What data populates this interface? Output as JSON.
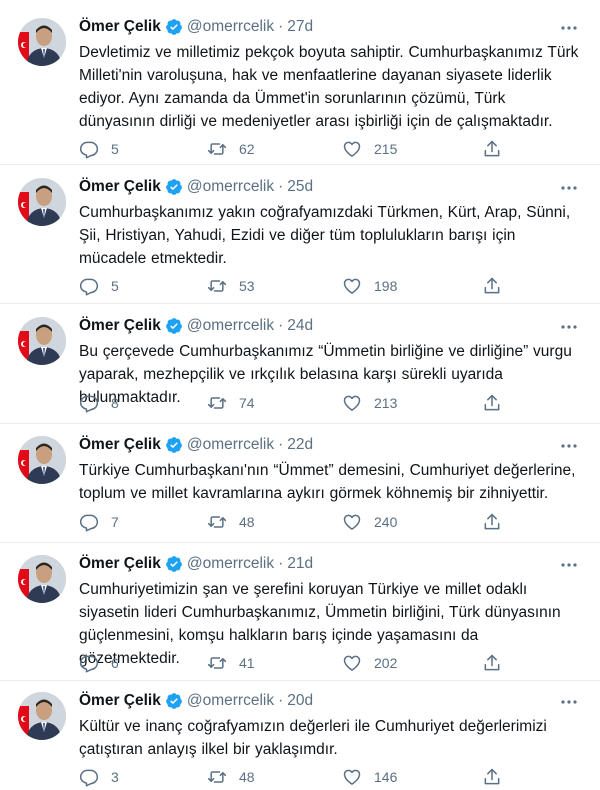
{
  "colors": {
    "text": "#0f1419",
    "secondary": "#5b7083",
    "verified_blue": "#1da1f2",
    "divider": "#e6ecf0",
    "flag_red": "#e30a17"
  },
  "icons": {
    "verified": "verified-badge-icon",
    "more": "more-horizontal-icon",
    "reply": "reply-icon",
    "retweet": "retweet-icon",
    "like": "heart-icon",
    "share": "share-icon"
  },
  "tweets": [
    {
      "author": {
        "name": "Ömer Çelik",
        "handle": "@omerrcelik"
      },
      "separator": "·",
      "time": "27d",
      "text": "Devletimiz ve milletimiz  pekçok boyuta sahiptir. Cumhurbaşkanımız Türk Milleti'nin varoluşuna, hak ve menfaatlerine dayanan siyasete liderlik ediyor. Aynı zamanda da Ümmet'in sorunlarının çözümü, Türk dünyasının dirliği ve medeniyetler arası işbirliği için de çalışmaktadır.",
      "replies": "5",
      "retweets": "62",
      "likes": "215"
    },
    {
      "author": {
        "name": "Ömer Çelik",
        "handle": "@omerrcelik"
      },
      "separator": "·",
      "time": "25d",
      "text": "Cumhurbaşkanımız yakın coğrafyamızdaki Türkmen, Kürt, Arap, Sünni, Şii, Hristiyan, Yahudi, Ezidi ve diğer tüm toplulukların barışı için mücadele etmektedir.",
      "replies": "5",
      "retweets": "53",
      "likes": "198"
    },
    {
      "author": {
        "name": "Ömer Çelik",
        "handle": "@omerrcelik"
      },
      "separator": "·",
      "time": "24d",
      "text": "Bu çerçevede Cumhurbaşkanımız “Ümmetin birliğine ve dirliğine” vurgu yaparak, mezhepçilik ve ırkçılık belasına karşı sürekli uyarıda bulunmaktadır.",
      "replies": "8",
      "retweets": "74",
      "likes": "213"
    },
    {
      "author": {
        "name": "Ömer Çelik",
        "handle": "@omerrcelik"
      },
      "separator": "·",
      "time": "22d",
      "text": "Türkiye Cumhurbaşkanı'nın “Ümmet” demesini, Cumhuriyet değerlerine, toplum ve millet kavramlarına aykırı görmek köhnemiş bir zihniyettir.",
      "replies": "7",
      "retweets": "48",
      "likes": "240"
    },
    {
      "author": {
        "name": "Ömer Çelik",
        "handle": "@omerrcelik"
      },
      "separator": "·",
      "time": "21d",
      "text": "Cumhuriyetimizin şan ve şerefini koruyan Türkiye ve millet odaklı siyasetin lideri Cumhurbaşkanımız, Ümmetin birliğini, Türk dünyasının güçlenmesini, komşu halkların barış içinde yaşamasını da gözetmektedir.",
      "replies": "6",
      "retweets": "41",
      "likes": "202"
    },
    {
      "author": {
        "name": "Ömer Çelik",
        "handle": "@omerrcelik"
      },
      "separator": "·",
      "time": "20d",
      "text": "Kültür ve inanç coğrafyamızın değerleri ile Cumhuriyet değerlerimizi çatıştıran anlayış ilkel bir yaklaşımdır.",
      "replies": "3",
      "retweets": "48",
      "likes": "146"
    }
  ]
}
